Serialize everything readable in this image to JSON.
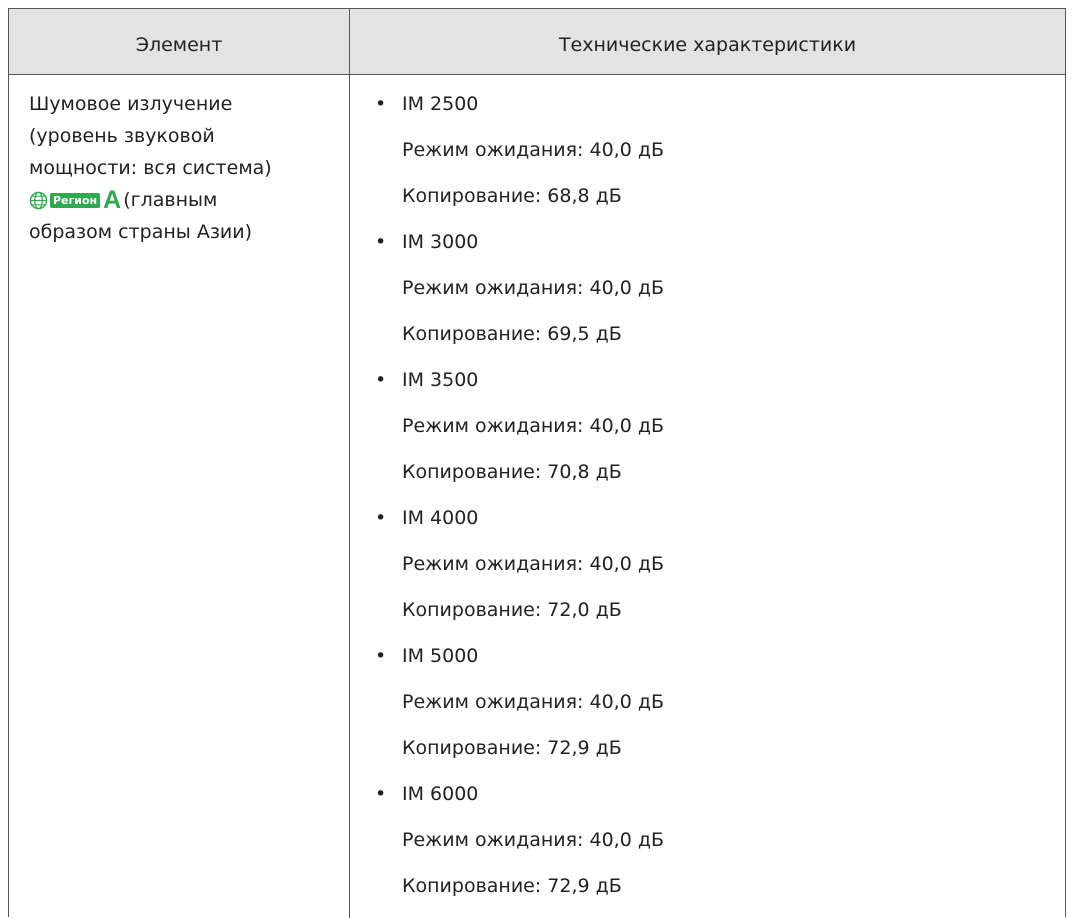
{
  "table": {
    "header": {
      "col_item": "Элемент",
      "col_spec": "Технические характеристики"
    },
    "item": {
      "line1": "Шумовое излучение",
      "line2": "(уровень звуковой",
      "line3": "мощности: вся система)",
      "region_label": "Регион",
      "region_letter": "A",
      "region_suffix": "(главным",
      "line5": "образом страны Азии)",
      "icons": {
        "globe": "globe-icon"
      },
      "colors": {
        "region": "#2fa84f"
      }
    },
    "models": [
      {
        "name": "IM 2500",
        "standby": "Режим ожидания: 40,0 дБ",
        "copying": "Копирование: 68,8 дБ"
      },
      {
        "name": "IM 3000",
        "standby": "Режим ожидания: 40,0 дБ",
        "copying": "Копирование: 69,5 дБ"
      },
      {
        "name": "IM 3500",
        "standby": "Режим ожидания: 40,0 дБ",
        "copying": "Копирование: 70,8 дБ"
      },
      {
        "name": "IM 4000",
        "standby": "Режим ожидания: 40,0 дБ",
        "copying": "Копирование: 72,0 дБ"
      },
      {
        "name": "IM 5000",
        "standby": "Режим ожидания: 40,0 дБ",
        "copying": "Копирование: 72,9 дБ"
      },
      {
        "name": "IM 6000",
        "standby": "Режим ожидания: 40,0 дБ",
        "copying": "Копирование: 72,9 дБ"
      }
    ],
    "bullet_symbol": "•"
  }
}
